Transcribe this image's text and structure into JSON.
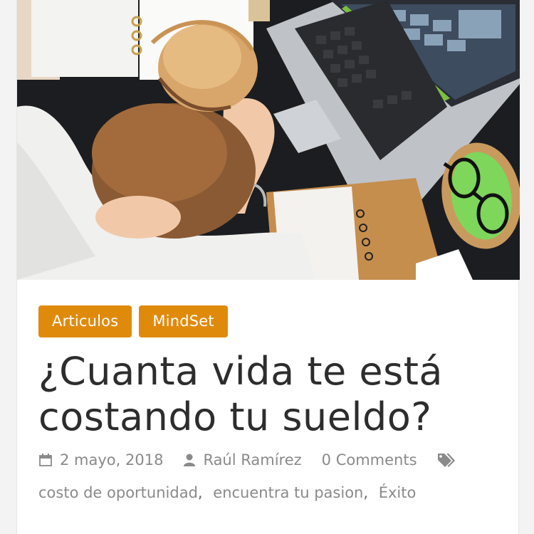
{
  "post": {
    "categories": [
      "Articulos",
      "MindSet"
    ],
    "title_line1": "¿Cuanta vida te está",
    "title_line2": "costando tu sueldo?",
    "date": "2 mayo, 2018",
    "author": "Raúl Ramírez",
    "comments": "0 Comments",
    "tags": [
      "costo de oportunidad",
      "encuentra tu pasion",
      "Éxito"
    ],
    "tag_separator": ","
  },
  "hero_image": {
    "description_icon": "photo-stressed-woman-at-desk"
  },
  "colors": {
    "category_bg": "#e08a0c",
    "title_text": "#2d2d2d",
    "meta_text": "#8a8a8a",
    "card_bg": "#ffffff",
    "page_bg": "#f3f3f3"
  },
  "icons": {
    "date": "calendar-icon",
    "author": "user-icon",
    "tags": "tags-icon"
  }
}
